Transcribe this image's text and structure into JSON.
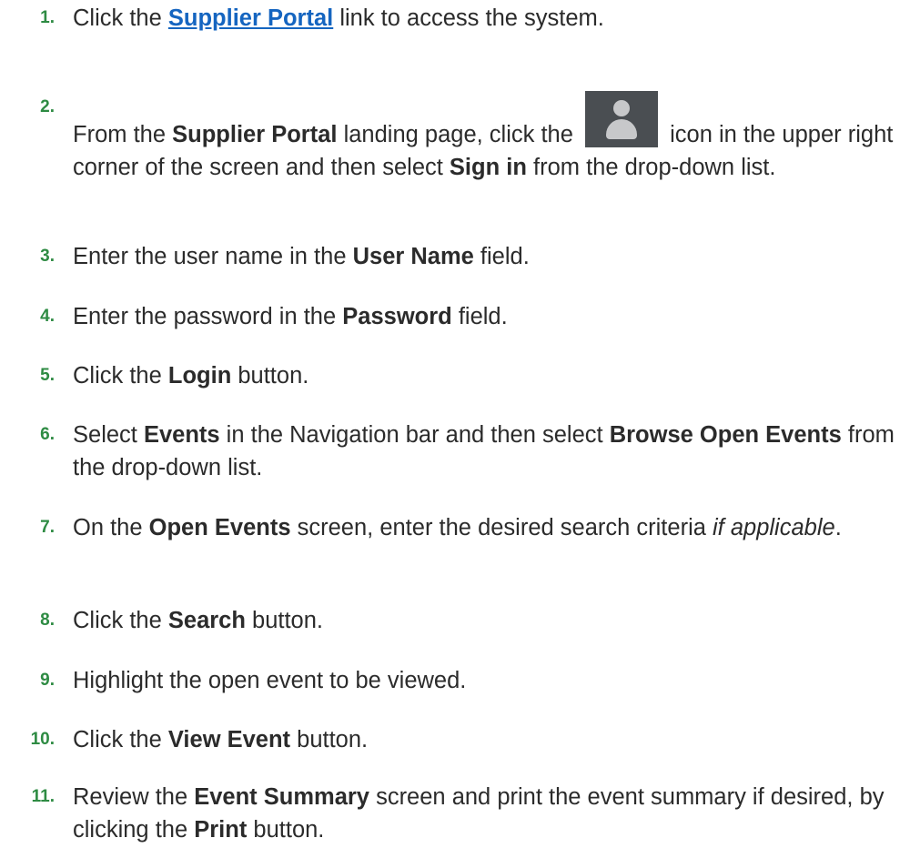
{
  "steps": [
    {
      "number": "1.",
      "before": "Click the ",
      "link": "Supplier Portal",
      "after": " link to access the system."
    },
    {
      "number": "2.",
      "t1": "From the ",
      "b1": "Supplier Portal",
      "t2": " landing page, click the ",
      "icon": "user-avatar-icon",
      "t3": " icon in the upper right corner of the screen and then select ",
      "b2": "Sign in",
      "t4": " from the drop-down list."
    },
    {
      "number": "3.",
      "t1": "Enter the user name in the ",
      "b1": "User Name",
      "t2": " field."
    },
    {
      "number": "4.",
      "t1": "Enter the password in the ",
      "b1": "Password",
      "t2": " field."
    },
    {
      "number": "5.",
      "t1": "Click the ",
      "b1": "Login",
      "t2": " button."
    },
    {
      "number": "6.",
      "t1": "Select ",
      "b1": "Events",
      "t2": " in the Navigation bar and then select ",
      "b2": "Browse Open Events",
      "t3": " from the drop-down list."
    },
    {
      "number": "7.",
      "t1": "On the ",
      "b1": "Open Events",
      "t2": " screen, enter the desired search criteria ",
      "i1": "if applicable",
      "t3": "."
    },
    {
      "number": "8.",
      "t1": "Click the ",
      "b1": "Search",
      "t2": " button."
    },
    {
      "number": "9.",
      "t1": "Highlight the open event to be viewed."
    },
    {
      "number": "10.",
      "t1": "Click the ",
      "b1": "View Event",
      "t2": " button."
    },
    {
      "number": "11.",
      "t1": "Review the ",
      "b1": "Event Summary",
      "t2": " screen and print the event summary if desired, by clicking the ",
      "b2": "Print",
      "t3": " button."
    }
  ],
  "colors": {
    "step_number": "#2e8b43",
    "link": "#1565c0",
    "body_text": "#2b2b2b",
    "avatar_bg": "#4a4e52",
    "avatar_fg": "#c7c8ca"
  }
}
